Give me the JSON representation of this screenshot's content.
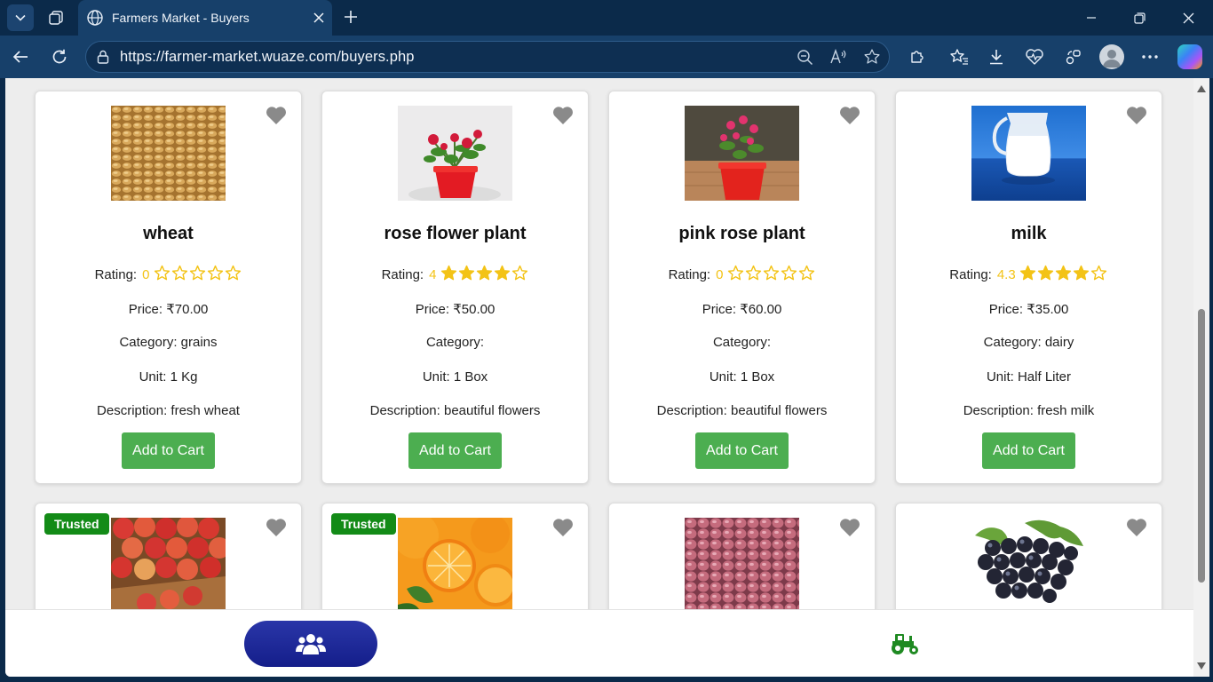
{
  "browser": {
    "tab_title": "Farmers Market - Buyers",
    "url": "https://farmer-market.wuaze.com/buyers.php"
  },
  "colors": {
    "star": "#f3c316",
    "button": "#4cae50",
    "trusted": "#138b17",
    "nav_active": "#1a2595",
    "tractor": "#1f8a22"
  },
  "products": [
    {
      "name": "wheat",
      "rating_label": "Rating:",
      "rating": "0",
      "stars_filled": 0,
      "price": "Price: ₹70.00",
      "category": "Category: grains",
      "unit": "Unit: 1 Kg",
      "description": "Description: fresh wheat",
      "button": "Add to Cart",
      "image": "wheat-grains"
    },
    {
      "name": "rose flower plant",
      "rating_label": "Rating:",
      "rating": "4",
      "stars_filled": 4,
      "price": "Price: ₹50.00",
      "category": "Category:",
      "unit": "Unit: 1 Box",
      "description": "Description: beautiful flowers",
      "button": "Add to Cart",
      "image": "red-rose-pot"
    },
    {
      "name": "pink rose plant",
      "rating_label": "Rating:",
      "rating": "0",
      "stars_filled": 0,
      "price": "Price: ₹60.00",
      "category": "Category:",
      "unit": "Unit: 1 Box",
      "description": "Description: beautiful flowers",
      "button": "Add to Cart",
      "image": "pink-rose-pot"
    },
    {
      "name": "milk",
      "rating_label": "Rating:",
      "rating": "4.3",
      "stars_filled": 4,
      "price": "Price: ₹35.00",
      "category": "Category: dairy",
      "unit": "Unit: Half Liter",
      "description": "Description: fresh milk",
      "button": "Add to Cart",
      "image": "milk-jug"
    }
  ],
  "products_row2": [
    {
      "badge": "Trusted",
      "image": "apples"
    },
    {
      "badge": "Trusted",
      "image": "oranges"
    },
    {
      "badge": "",
      "image": "onions"
    },
    {
      "badge": "",
      "image": "grapes"
    }
  ]
}
